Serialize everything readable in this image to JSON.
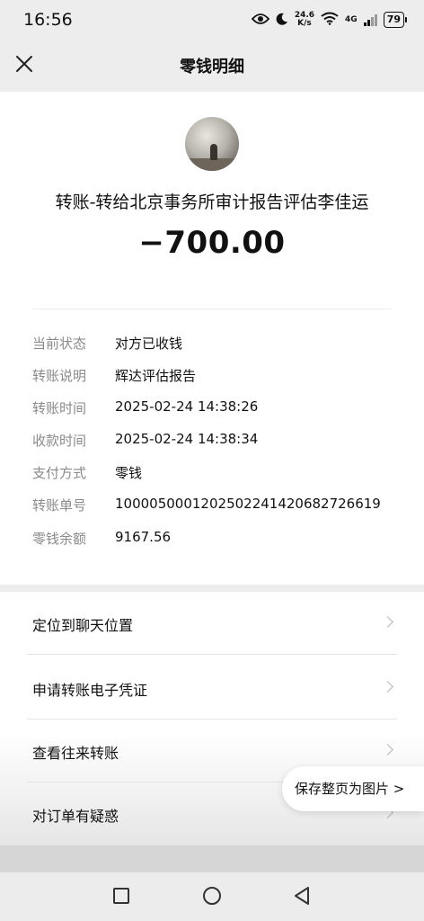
{
  "status_bar": {
    "time": "16:56",
    "net_speed_value": "24.6",
    "net_speed_unit": "K/s",
    "network_type": "4G",
    "battery": "79"
  },
  "nav": {
    "title": "零钱明细"
  },
  "transfer": {
    "title": "转账-转给北京事务所审计报告评估李佳运",
    "amount": "−700.00"
  },
  "details": [
    {
      "label": "当前状态",
      "value": "对方已收钱"
    },
    {
      "label": "转账说明",
      "value": "辉达评估报告"
    },
    {
      "label": "转账时间",
      "value": "2025-02-24 14:38:26"
    },
    {
      "label": "收款时间",
      "value": "2025-02-24 14:38:34"
    },
    {
      "label": "支付方式",
      "value": "零钱"
    },
    {
      "label": "转账单号",
      "value": "1000050001202502241420682726619"
    },
    {
      "label": "零钱余额",
      "value": "9167.56"
    }
  ],
  "actions": [
    {
      "label": "定位到聊天位置"
    },
    {
      "label": "申请转账电子凭证"
    },
    {
      "label": "查看往来转账"
    },
    {
      "label": "对订单有疑惑"
    }
  ],
  "save_page_label": "保存整页为图片 >",
  "icons": {
    "eye": "eye-icon",
    "moon": "moon-icon",
    "wifi": "wifi-icon",
    "signal": "signal-icon",
    "close": "close-icon",
    "chevron": "chevron-right-icon",
    "recents": "square-icon",
    "home": "circle-icon",
    "back": "triangle-back-icon"
  }
}
